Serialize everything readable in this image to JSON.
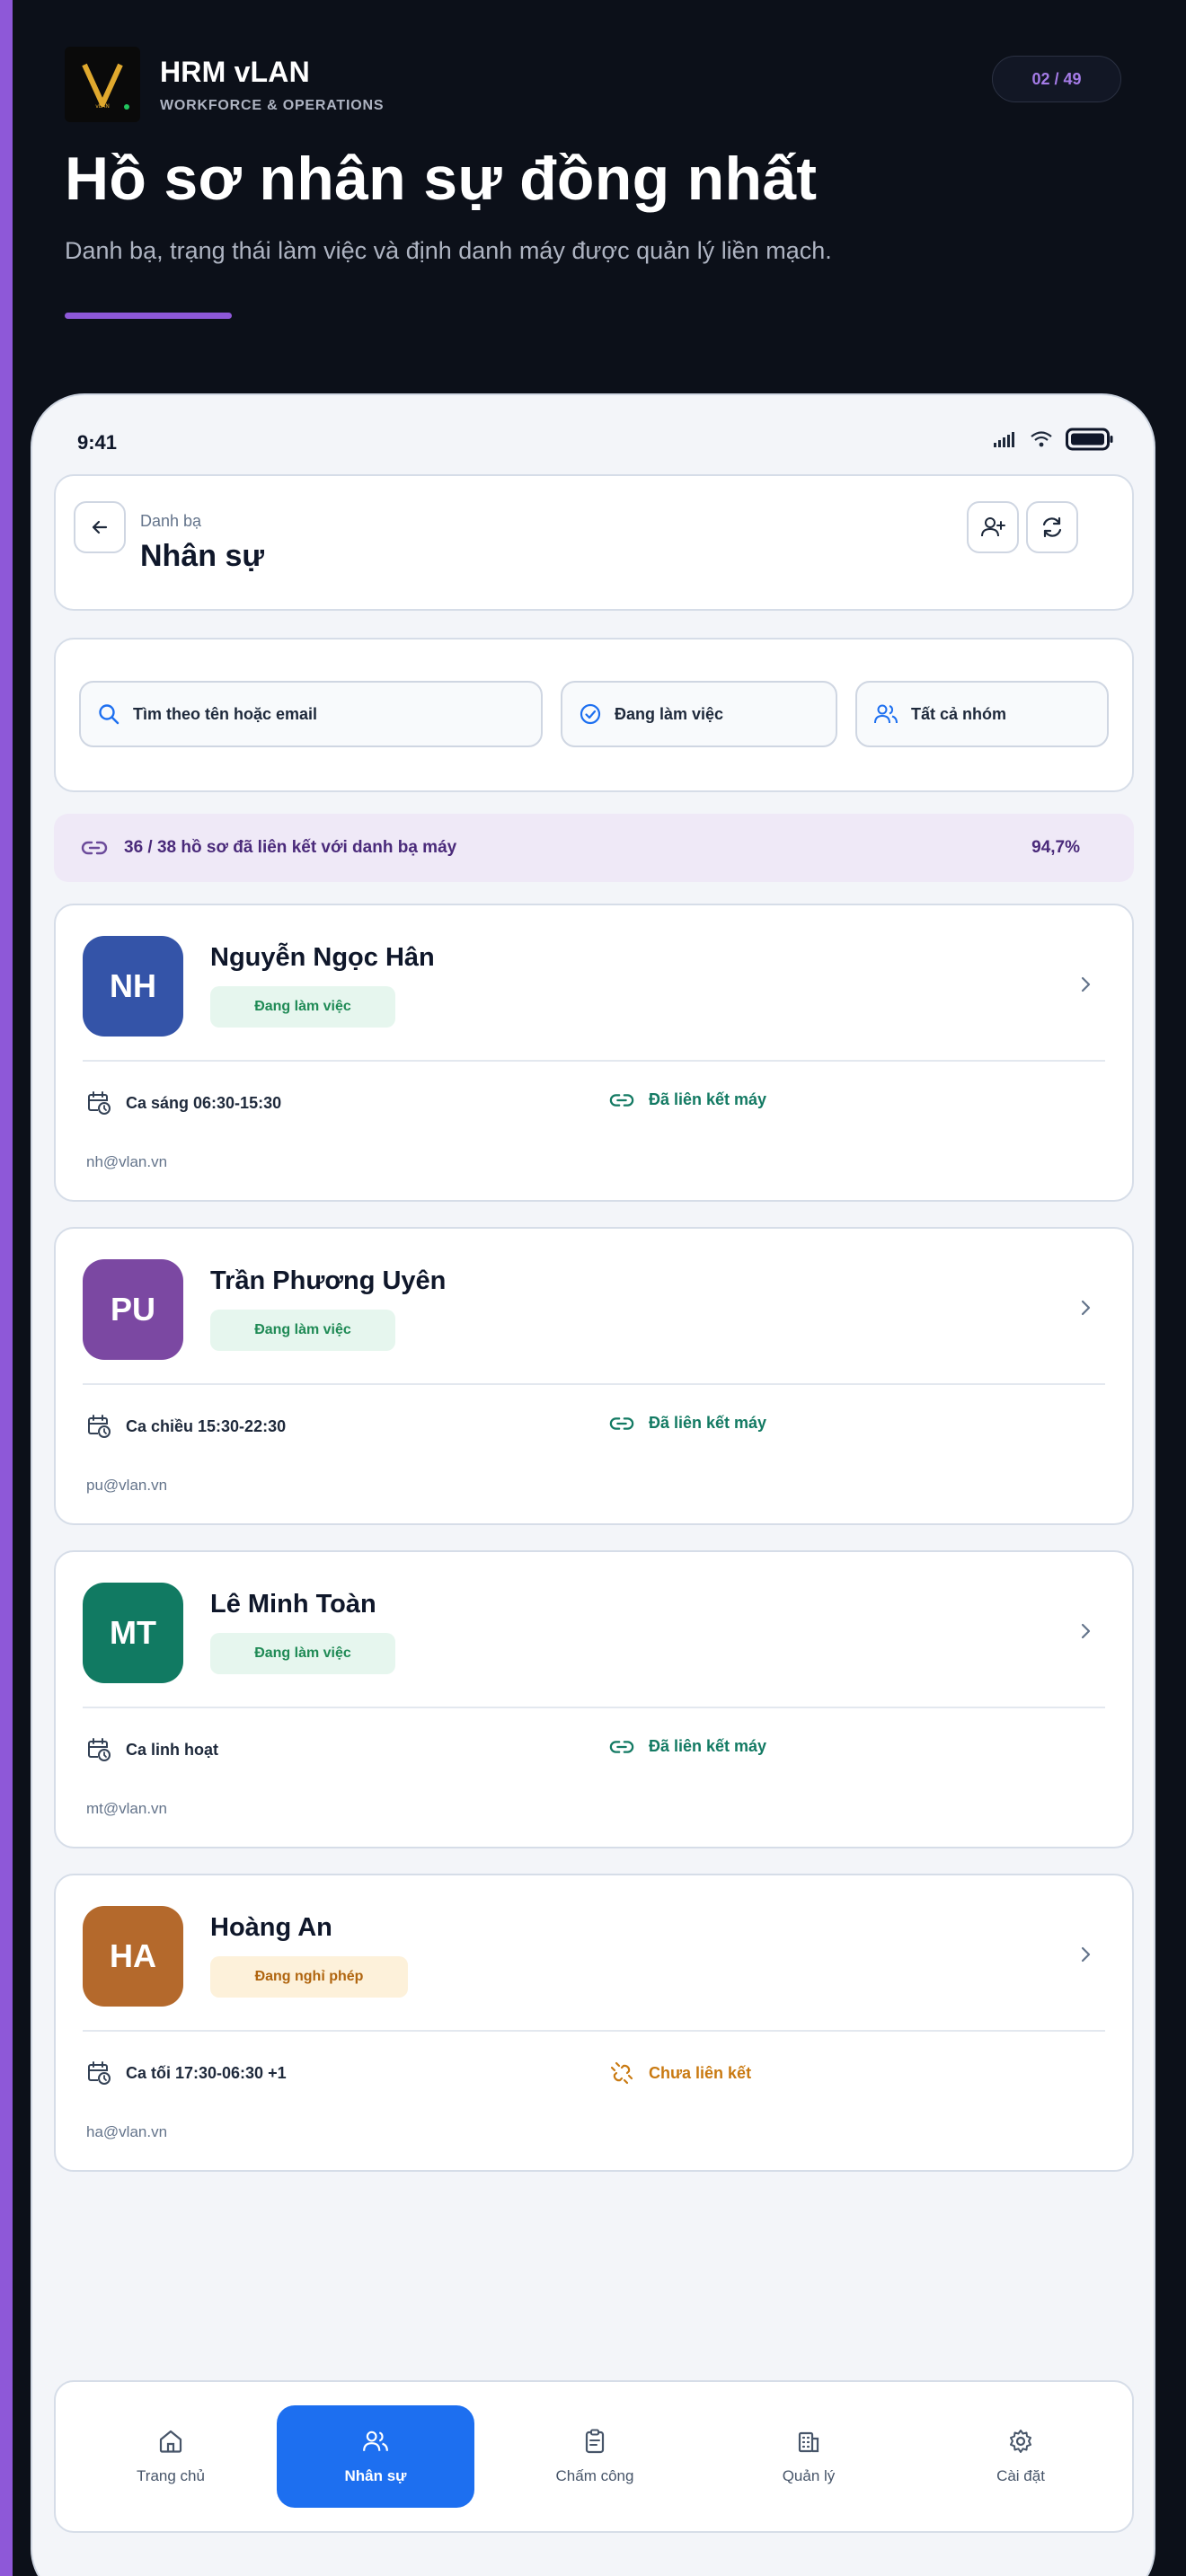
{
  "brand": {
    "name": "HRM vLAN",
    "subtitle": "WORKFORCE & OPERATIONS",
    "logo_icon": "v-logo-icon"
  },
  "page_counter": "02 / 49",
  "hero": {
    "title": "Hồ sơ nhân sự đồng nhất",
    "subtitle": "Danh bạ, trạng thái làm việc và định danh máy được quản lý liền mạch."
  },
  "device": {
    "time": "9:41",
    "header": {
      "breadcrumb": "Danh bạ",
      "title": "Nhân sự"
    },
    "filters": {
      "search_label": "Tìm theo tên hoặc email",
      "status_label": "Đang làm việc",
      "group_label": "Tất cả nhóm"
    },
    "link_banner": {
      "text": "36 / 38 hồ sơ đã liên kết với danh bạ máy",
      "percent": "94,7%"
    },
    "employees": [
      {
        "initials": "NH",
        "name": "Nguyễn Ngọc Hân",
        "status": "Đang làm việc",
        "shift": "Ca sáng 06:30-15:30",
        "link_status": "Đã liên kết máy",
        "email": "nh@vlan.vn",
        "avatar_color": "#3454a8"
      },
      {
        "initials": "PU",
        "name": "Trần Phương Uyên",
        "status": "Đang làm việc",
        "shift": "Ca chiều 15:30-22:30",
        "link_status": "Đã liên kết máy",
        "email": "pu@vlan.vn",
        "avatar_color": "#7b48a2"
      },
      {
        "initials": "MT",
        "name": "Lê Minh Toàn",
        "status": "Đang làm việc",
        "shift": "Ca linh hoạt",
        "link_status": "Đã liên kết máy",
        "email": "mt@vlan.vn",
        "avatar_color": "#117a62"
      },
      {
        "initials": "HA",
        "name": "Hoàng An",
        "status": "Đang nghỉ phép",
        "shift": "Ca tối 17:30-06:30 +1",
        "link_status": "Chưa liên kết",
        "email": "ha@vlan.vn",
        "avatar_color": "#b4692c"
      }
    ],
    "nav": {
      "home": "Trang chủ",
      "people": "Nhân sự",
      "attendance": "Chấm công",
      "manage": "Quản lý",
      "settings": "Cài đặt"
    }
  },
  "colors": {
    "accent_purple": "#8e58d8",
    "primary_blue": "#1d6ff0",
    "working_bg": "#e6f6ee",
    "working_text": "#1f8a55",
    "leave_bg": "#fdf1da",
    "leave_text": "#b0650f",
    "linked_text": "#137a63",
    "unlinked_text": "#c97a12"
  }
}
